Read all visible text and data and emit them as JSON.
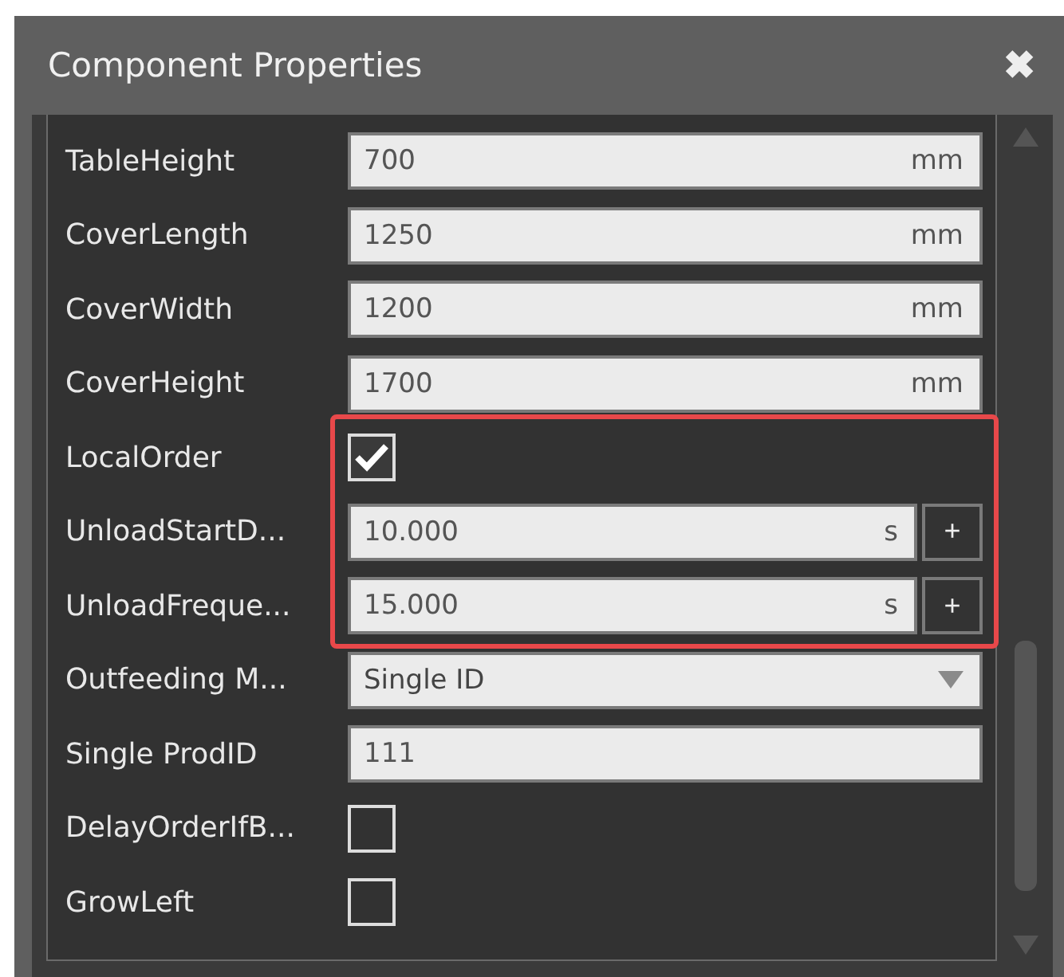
{
  "window": {
    "title": "Component Properties",
    "close": "✖"
  },
  "rows": [
    {
      "kind": "number",
      "label": "TableHeight",
      "value": "700",
      "unit": "mm",
      "highlighted": false
    },
    {
      "kind": "number",
      "label": "CoverLength",
      "value": "1250",
      "unit": "mm",
      "highlighted": false
    },
    {
      "kind": "number",
      "label": "CoverWidth",
      "value": "1200",
      "unit": "mm",
      "highlighted": false
    },
    {
      "kind": "number",
      "label": "CoverHeight",
      "value": "1700",
      "unit": "mm",
      "highlighted": false
    },
    {
      "kind": "checkbox",
      "label": "LocalOrder",
      "checked": true,
      "highlighted": true
    },
    {
      "kind": "number_plus",
      "label": "UnloadStartD...",
      "value": "10.000",
      "unit": "s",
      "plus": "+",
      "highlighted": true
    },
    {
      "kind": "number_plus",
      "label": "UnloadFreque...",
      "value": "15.000",
      "unit": "s",
      "plus": "+",
      "highlighted": true
    },
    {
      "kind": "dropdown",
      "label": "Outfeeding M...",
      "value": "Single ID",
      "highlighted": false
    },
    {
      "kind": "text",
      "label": "Single ProdID",
      "value": "111",
      "highlighted": false
    },
    {
      "kind": "checkbox",
      "label": "DelayOrderIfB...",
      "checked": false,
      "highlighted": false
    },
    {
      "kind": "checkbox",
      "label": "GrowLeft",
      "checked": false,
      "highlighted": false
    }
  ]
}
